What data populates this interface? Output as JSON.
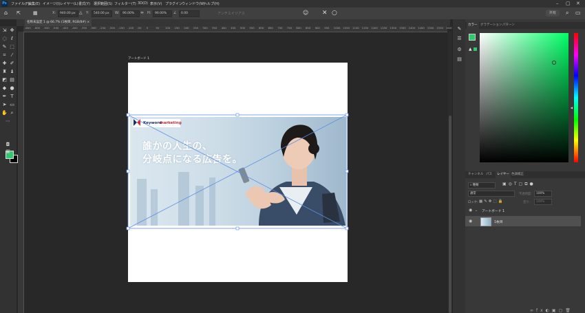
{
  "app": {
    "logo": "Ps",
    "accent": "#31a8ff"
  },
  "menu": [
    "ファイル(F)",
    "編集(E)",
    "イメージ(I)",
    "レイヤー(L)",
    "書式(Y)",
    "選択範囲(S)",
    "フィルター(T)",
    "3D(D)",
    "表示(V)",
    "プラグイン",
    "ウィンドウ(W)",
    "ヘルプ(H)"
  ],
  "options": {
    "x_label": "X:",
    "x_value": "940.00 px",
    "y_label": "Y:",
    "y_value": "540.00 px",
    "w_label": "W:",
    "w_value": "90.00%",
    "h_label": "H:",
    "h_value": "90.00%",
    "angle_label": "∠",
    "angle_value": "0.00",
    "interp_label": "アンチエイリアス",
    "share_label": "共有"
  },
  "document": {
    "tab_title": "名称未設定 1 @ 66.7% (1枚目, RGB/8#)"
  },
  "ruler": {
    "labels": [
      "-650",
      "-600",
      "-550",
      "-500",
      "-450",
      "-400",
      "-350",
      "-300",
      "-250",
      "-200",
      "-150",
      "-100",
      "-50",
      "0",
      "50",
      "100",
      "150",
      "200",
      "250",
      "300",
      "350",
      "400",
      "450",
      "500",
      "550",
      "600",
      "650",
      "700",
      "750",
      "800",
      "850",
      "900",
      "950",
      "1000",
      "1050",
      "1100",
      "1150",
      "1200",
      "1250",
      "1300",
      "1350",
      "1400",
      "1450",
      "1500",
      "1550",
      "1600"
    ]
  },
  "artboard": {
    "label": "アートボード 1"
  },
  "banner": {
    "logo_text_1": "Keyword",
    "logo_text_2": "marketing",
    "headline_1": "誰かの人生の、",
    "headline_2": "分岐点になる広告を。"
  },
  "swatches": {
    "foreground": "#2fc86c",
    "background": "#000000"
  },
  "color_panel": {
    "tabs": [
      "カラー",
      "グラデーション",
      "パターン"
    ]
  },
  "layers_panel": {
    "tabs": [
      "チャンネル",
      "パス",
      "レイヤー",
      "色調補正"
    ],
    "search_placeholder": "種類",
    "blend_mode": "通常",
    "opacity_label": "不透明度:",
    "opacity_value": "100%",
    "lock_label": "ロック:",
    "fill_label": "塗り:",
    "fill_value": "100%",
    "layers": [
      {
        "name": "アートボード 1"
      },
      {
        "name": "1枚目"
      }
    ]
  }
}
